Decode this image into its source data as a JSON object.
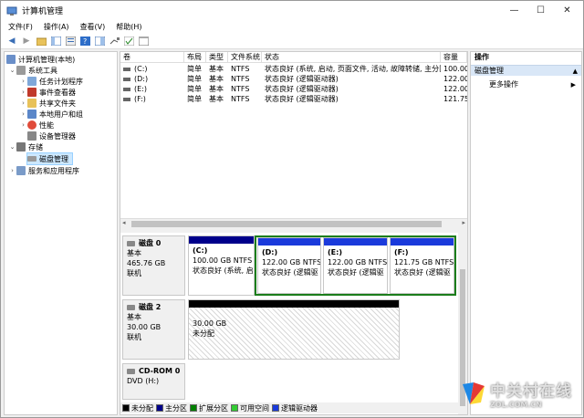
{
  "window": {
    "title": "计算机管理",
    "min": "—",
    "max": "☐",
    "close": "✕"
  },
  "menu": [
    "文件(F)",
    "操作(A)",
    "查看(V)",
    "帮助(H)"
  ],
  "toolbar": {
    "back": "◀",
    "forward": "▶"
  },
  "tree": {
    "root": "计算机管理(本地)",
    "system_tools": "系统工具",
    "task_scheduler": "任务计划程序",
    "event_viewer": "事件查看器",
    "shared_folders": "共享文件夹",
    "local_users": "本地用户和组",
    "performance": "性能",
    "device_manager": "设备管理器",
    "storage": "存储",
    "disk_mgmt": "磁盘管理",
    "services": "服务和应用程序"
  },
  "volumes": {
    "headers": [
      "卷",
      "布局",
      "类型",
      "文件系统",
      "状态",
      "容量"
    ],
    "rows": [
      [
        "(C:)",
        "简单",
        "基本",
        "NTFS",
        "状态良好 (系统, 启动, 页面文件, 活动, 故障转储, 主分区)",
        "100.00"
      ],
      [
        "(D:)",
        "简单",
        "基本",
        "NTFS",
        "状态良好 (逻辑驱动器)",
        "122.00"
      ],
      [
        "(E:)",
        "简单",
        "基本",
        "NTFS",
        "状态良好 (逻辑驱动器)",
        "122.00"
      ],
      [
        "(F:)",
        "简单",
        "基本",
        "NTFS",
        "状态良好 (逻辑驱动器)",
        "121.75"
      ]
    ]
  },
  "disks": [
    {
      "name": "磁盘 0",
      "type": "基本",
      "size": "465.76 GB",
      "status": "联机",
      "parts": [
        {
          "label": "(C:)",
          "size": "100.00 GB NTFS",
          "status": "状态良好 (系统, 启"
        },
        {
          "label": "(D:)",
          "size": "122.00 GB NTFS",
          "status": "状态良好 (逻辑驱"
        },
        {
          "label": "(E:)",
          "size": "122.00 GB NTFS",
          "status": "状态良好 (逻辑驱"
        },
        {
          "label": "(F:)",
          "size": "121.75 GB NTFS",
          "status": "状态良好 (逻辑驱"
        }
      ]
    },
    {
      "name": "磁盘 2",
      "type": "基本",
      "size": "30.00 GB",
      "status": "联机",
      "parts": [
        {
          "size": "30.00 GB",
          "status": "未分配"
        }
      ]
    },
    {
      "name": "CD-ROM 0",
      "type": "DVD (H:)"
    }
  ],
  "legend": [
    "未分配",
    "主分区",
    "扩展分区",
    "可用空间",
    "逻辑驱动器"
  ],
  "colors": {
    "unallocated": "#000000",
    "primary": "#00008b",
    "extended": "#008000",
    "free": "#33cc33",
    "logical": "#1a3adb",
    "selected_border": "#1b7d1b"
  },
  "actions": {
    "header": "操作",
    "section": "磁盘管理",
    "more": "更多操作",
    "more_arrow": "▶"
  },
  "watermark": {
    "brand": "中关村在线",
    "site": "ZOL.COM.CN"
  }
}
